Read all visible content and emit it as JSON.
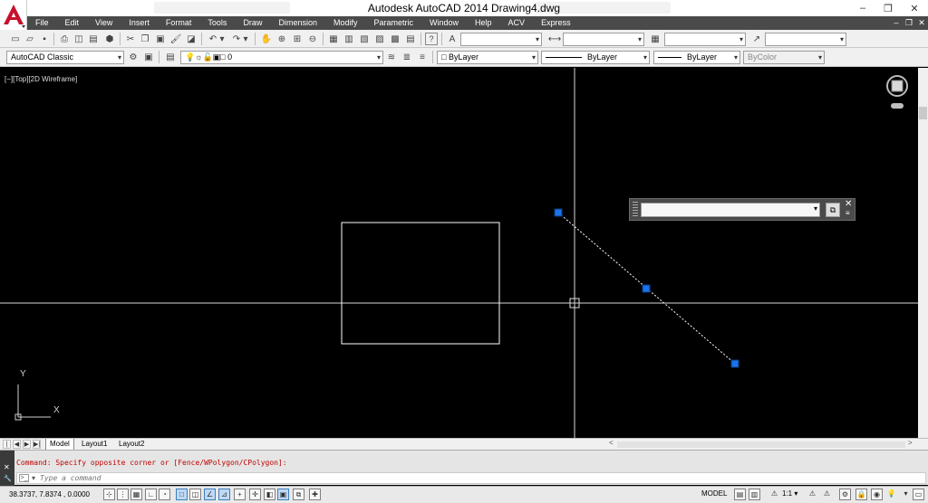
{
  "app": {
    "title": "Autodesk AutoCAD 2014    Drawing4.dwg"
  },
  "window_controls": {
    "minimize": "–",
    "restore": "❐",
    "close": "✕"
  },
  "menu": {
    "items": [
      "File",
      "Edit",
      "View",
      "Insert",
      "Format",
      "Tools",
      "Draw",
      "Dimension",
      "Modify",
      "Parametric",
      "Window",
      "Help",
      "ACV",
      "Express"
    ],
    "doc_controls": [
      "–",
      "❐",
      "✕"
    ]
  },
  "toolbar_standard": {
    "icons": [
      "new-icon",
      "open-icon",
      "save-icon",
      "plot-icon",
      "plot-preview-icon",
      "publish-icon",
      "3d-print-icon",
      "cut-icon",
      "copy-icon",
      "paste-icon",
      "match-properties-icon",
      "block-editor-icon",
      "undo-icon",
      "redo-icon",
      "pan-icon",
      "zoom-realtime-icon",
      "zoom-window-icon",
      "zoom-previous-icon",
      "properties-icon",
      "design-center-icon",
      "tool-palettes-icon",
      "sheet-set-icon",
      "markup-icon",
      "quickcalc-icon",
      "help-icon"
    ],
    "text_style_icon": "text-style-icon",
    "dim_style_icon": "dim-style-icon",
    "table_style_icon": "table-style-icon",
    "multileader_style_icon": "multileader-style-icon"
  },
  "toolbar_layers": {
    "workspace": "AutoCAD Classic",
    "layer": "0",
    "color": "ByLayer",
    "linetype": "ByLayer",
    "lineweight": "ByLayer",
    "plotstyle": "ByColor"
  },
  "viewport": {
    "label": "[−][Top][2D Wireframe]",
    "ucs_x": "X",
    "ucs_y": "Y"
  },
  "tabs": {
    "nav": [
      "|◀",
      "◀",
      "▶",
      "▶|"
    ],
    "items": [
      "Model",
      "Layout1",
      "Layout2"
    ],
    "active": "Model"
  },
  "command": {
    "history": "Command: Specify opposite corner or [Fence/WPolygon/CPolygon]:",
    "placeholder": "Type a command",
    "side_close": "✕",
    "side_wrench": "🔧"
  },
  "status": {
    "coordinates": "38.3737, 7.8374 , 0.0000",
    "model": "MODEL",
    "scale": "1:1 ▾"
  },
  "colors": {
    "canvas": "#000000",
    "grip": "#1a73e8",
    "menubar": "#4a4a4a",
    "command_text": "#c00000"
  }
}
